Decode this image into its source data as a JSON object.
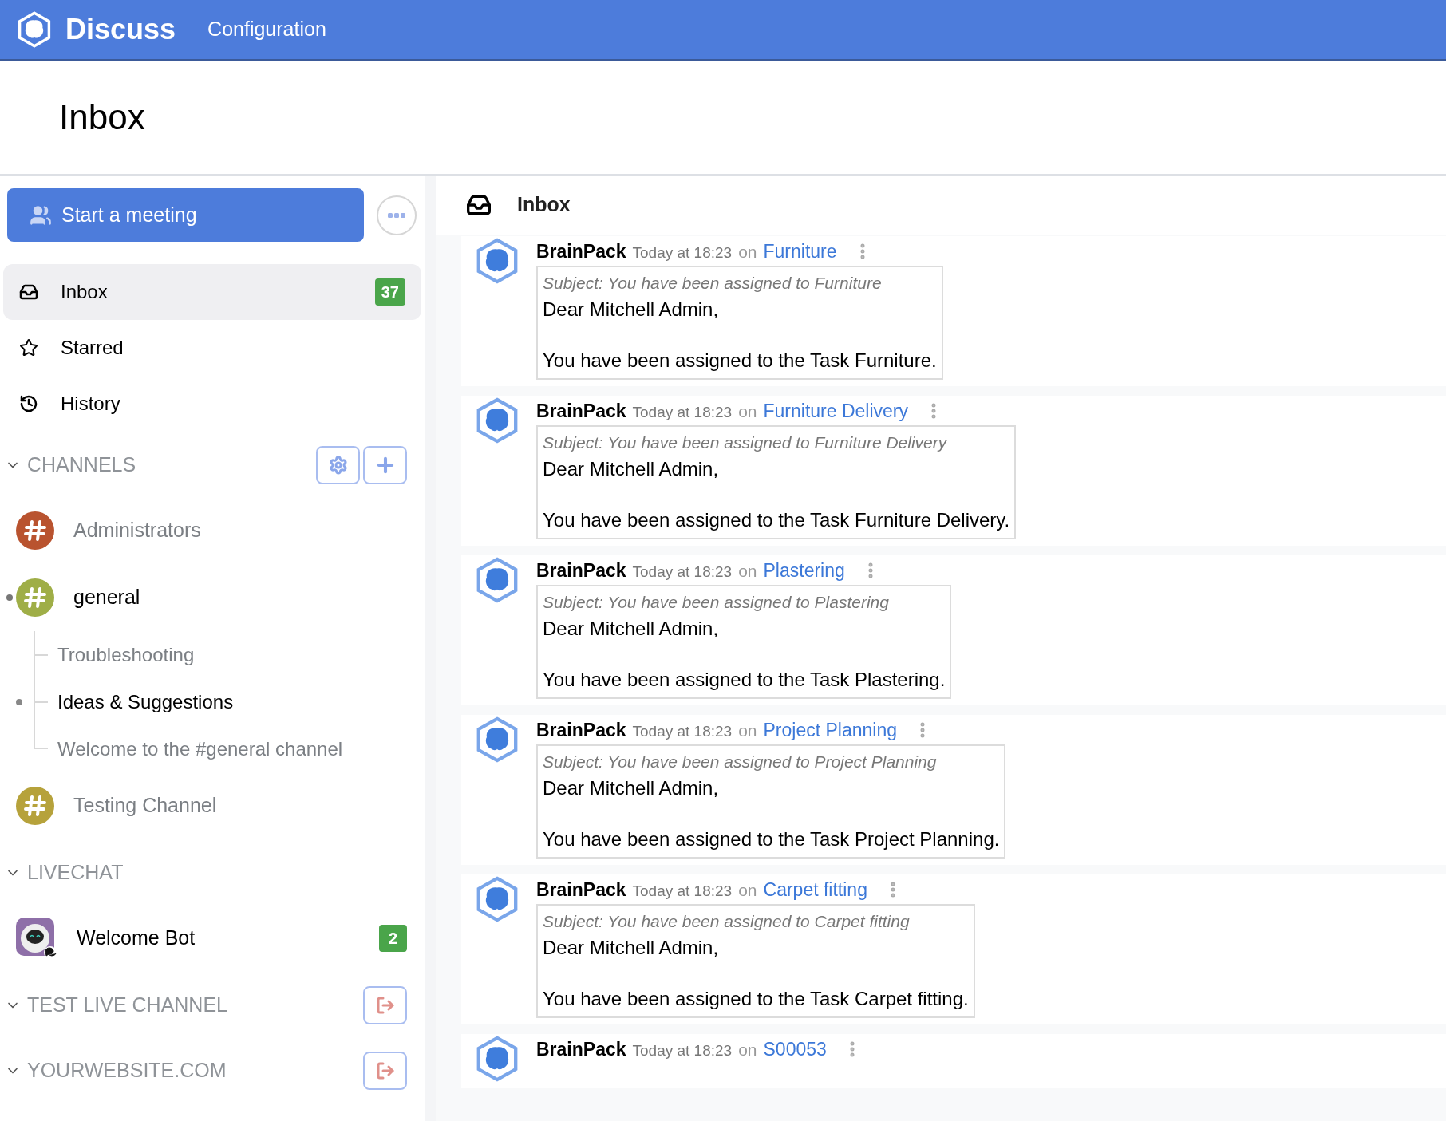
{
  "navbar": {
    "app_name": "Discuss",
    "menu": [
      {
        "label": "Configuration"
      }
    ]
  },
  "page_title": "Inbox",
  "sidebar": {
    "start_meeting": "Start a meeting",
    "mailboxes": [
      {
        "kind": "inbox",
        "label": "Inbox",
        "count": "37",
        "selected": true
      },
      {
        "kind": "star",
        "label": "Starred",
        "selected": false
      },
      {
        "kind": "history",
        "label": "History",
        "selected": false
      }
    ],
    "sections": [
      {
        "title": "CHANNELS",
        "expanded": true,
        "buttons": [
          {
            "kind": "settings"
          },
          {
            "kind": "add"
          }
        ],
        "items": [
          {
            "kind": "channel",
            "name": "Administrators",
            "color": "#b9532f",
            "unread": false
          },
          {
            "kind": "channel",
            "name": "general",
            "color": "#9fae47",
            "unread": true,
            "children": [
              {
                "name": "Troubleshooting",
                "unread": false
              },
              {
                "name": "Ideas & Suggestions",
                "unread": true
              },
              {
                "name": "Welcome to the #general channel",
                "unread": false
              }
            ]
          },
          {
            "kind": "channel",
            "name": "Testing Channel",
            "color": "#b6a23b",
            "unread": false
          }
        ]
      },
      {
        "title": "LIVECHAT",
        "expanded": true,
        "items": [
          {
            "kind": "bot",
            "name": "Welcome Bot",
            "unread": true,
            "count": "2"
          }
        ]
      },
      {
        "title": "TEST LIVE CHANNEL",
        "expanded": true,
        "buttons": [
          {
            "kind": "leave"
          }
        ]
      },
      {
        "title": "YOURWEBSITE.COM",
        "expanded": true,
        "buttons": [
          {
            "kind": "leave"
          }
        ]
      }
    ]
  },
  "thread": {
    "title": "Inbox",
    "messages": [
      {
        "author": "BrainPack",
        "date": "Today at 18:23",
        "connector": "on",
        "record": "Furniture",
        "subject": "Subject: You have been assigned to Furniture",
        "greeting": "Dear Mitchell Admin,",
        "body": "You have been assigned to the Task Furniture."
      },
      {
        "author": "BrainPack",
        "date": "Today at 18:23",
        "connector": "on",
        "record": "Furniture Delivery",
        "subject": "Subject: You have been assigned to Furniture Delivery",
        "greeting": "Dear Mitchell Admin,",
        "body": "You have been assigned to the Task Furniture Delivery."
      },
      {
        "author": "BrainPack",
        "date": "Today at 18:23",
        "connector": "on",
        "record": "Plastering",
        "subject": "Subject: You have been assigned to Plastering",
        "greeting": "Dear Mitchell Admin,",
        "body": "You have been assigned to the Task Plastering."
      },
      {
        "author": "BrainPack",
        "date": "Today at 18:23",
        "connector": "on",
        "record": "Project Planning",
        "subject": "Subject: You have been assigned to Project Planning",
        "greeting": "Dear Mitchell Admin,",
        "body": "You have been assigned to the Task Project Planning."
      },
      {
        "author": "BrainPack",
        "date": "Today at 18:23",
        "connector": "on",
        "record": "Carpet fitting",
        "subject": "Subject: You have been assigned to Carpet fitting",
        "greeting": "Dear Mitchell Admin,",
        "body": "You have been assigned to the Task Carpet fitting."
      },
      {
        "author": "BrainPack",
        "date": "Today at 18:23",
        "connector": "on",
        "record": "S00053"
      }
    ]
  }
}
